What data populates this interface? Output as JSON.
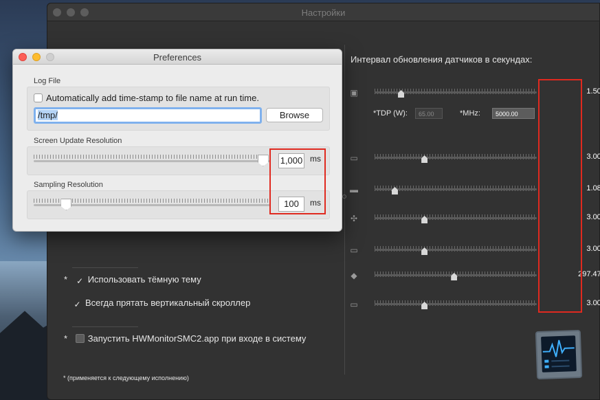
{
  "dark_window": {
    "title": "Настройки",
    "interval_label": "Интервал обновления датчиков в секундах:",
    "tdp_label": "*TDP (W):",
    "tdp_value": "65.00",
    "mhz_label": "*MHz:",
    "mhz_value": "5000.00",
    "sensors": [
      {
        "icon": "cpu-icon",
        "value": "1.50''",
        "level": 0.15
      },
      {
        "icon": "gpu-icon",
        "value": "3.00''",
        "level": 0.3
      },
      {
        "icon": "memory-icon",
        "value": "1.08''",
        "level": 0.11
      },
      {
        "icon": "fan-icon",
        "value": "3.00''",
        "level": 0.3
      },
      {
        "icon": "drive-icon",
        "value": "3.00''",
        "level": 0.3
      },
      {
        "icon": "network-icon",
        "value": "297.47''",
        "level": 0.49
      },
      {
        "icon": "battery-icon",
        "value": "3.00''",
        "level": 0.3
      }
    ],
    "options": {
      "dark_theme": {
        "marker": "*",
        "label": "Использовать тёмную тему",
        "checked": true
      },
      "hide_scroller": {
        "label": "Всегда прятать вертикальный скроллер",
        "checked": true
      },
      "launch_at_login": {
        "marker": "*",
        "label": "Запустить HWMonitorSMC2.app при входе в систему",
        "checked": false
      }
    },
    "footnote": "*  (применяется к следующему исполнению)"
  },
  "preferences": {
    "title": "Preferences",
    "log_file_label": "Log File",
    "timestamp_label": "Automatically add time-stamp to file name at run time.",
    "path_value": "/tmp/",
    "browse_label": "Browse",
    "screen_update_label": "Screen Update Resolution",
    "screen_update_value": "1,000",
    "screen_update_level": 0.99,
    "sampling_label": "Sampling Resolution",
    "sampling_value": "100",
    "sampling_level": 0.12,
    "unit_label": "ms"
  },
  "colors": {
    "highlight_red": "#e0291f",
    "mac_close": "#fc5f57",
    "mac_minimize": "#fdbc2e",
    "mac_zoom_inactive": "#cfcfcf"
  }
}
